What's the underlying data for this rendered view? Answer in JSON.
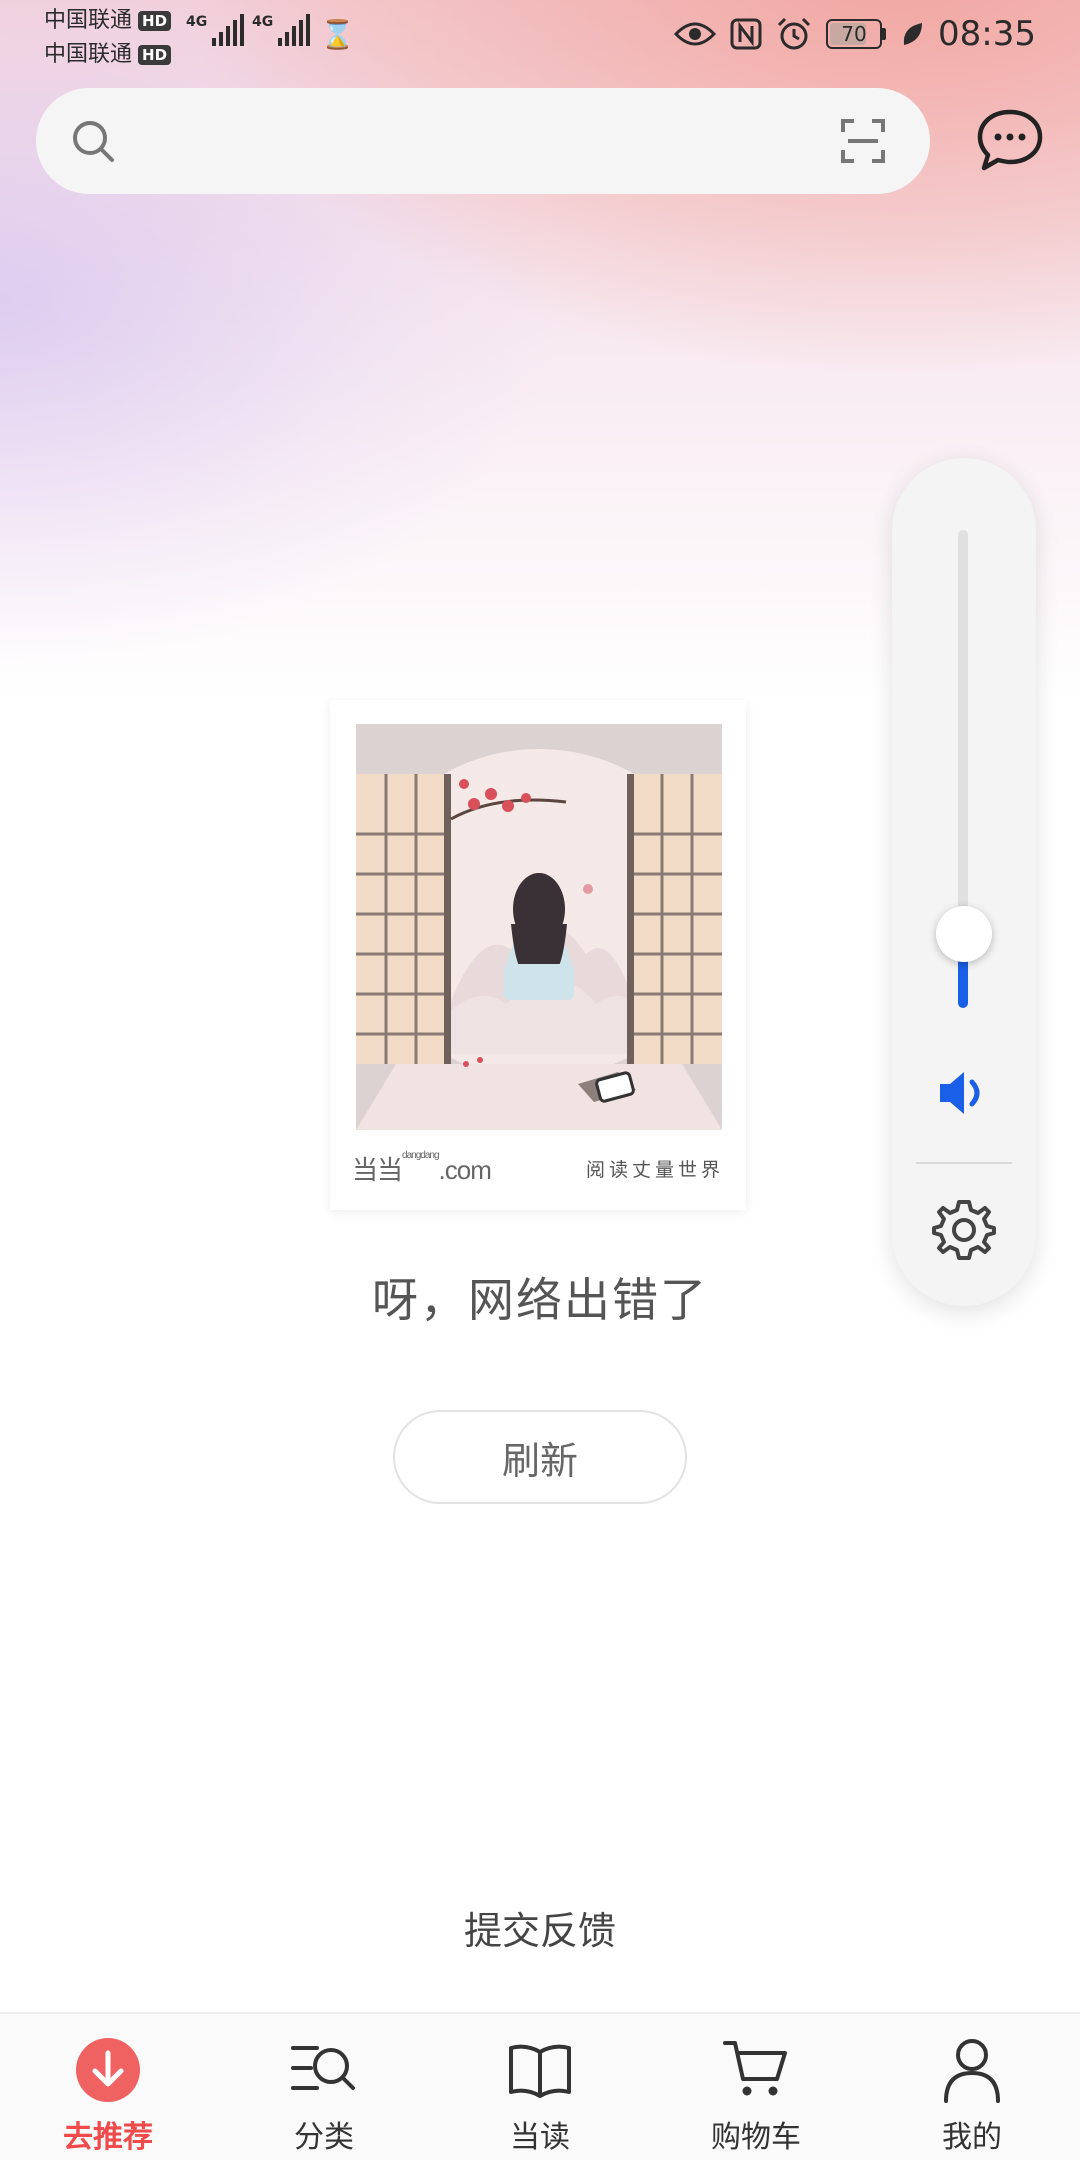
{
  "status_bar": {
    "carrier1": "中国联通",
    "carrier2": "中国联通",
    "hd_badge": "HD",
    "network1": "4G",
    "network2": "4G",
    "battery_level": "70",
    "time": "08:35"
  },
  "search": {
    "placeholder": ""
  },
  "volume": {
    "level": 0.1
  },
  "illustration": {
    "logo_text": "当当",
    "logo_domain": ".com",
    "logo_small": "dangdang",
    "slogan": "阅读丈量世界"
  },
  "error": {
    "message": "呀，网络出错了",
    "refresh_label": "刷新"
  },
  "feedback_label": "提交反馈",
  "nav": {
    "items": [
      {
        "label": "去推荐",
        "active": true
      },
      {
        "label": "分类",
        "active": false
      },
      {
        "label": "当读",
        "active": false
      },
      {
        "label": "购物车",
        "active": false
      },
      {
        "label": "我的",
        "active": false
      }
    ]
  },
  "colors": {
    "accent": "#f04a4a",
    "volume_fill": "#1a5fe8"
  }
}
